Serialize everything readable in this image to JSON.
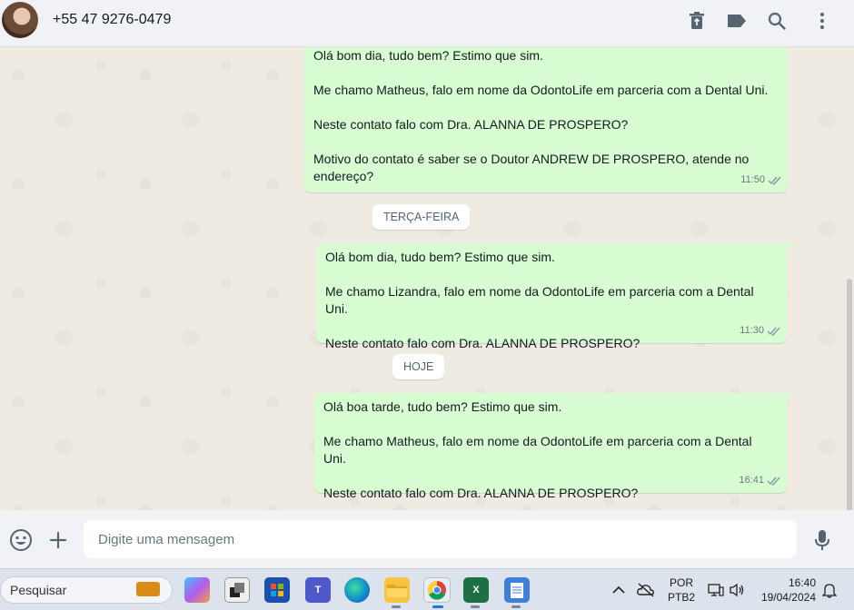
{
  "header": {
    "contact_name": "+55 47 9276-0479",
    "icons": [
      "delete-icon",
      "label-icon",
      "search-icon",
      "menu-icon"
    ]
  },
  "messages": [
    {
      "paragraphs": [
        "Olá bom dia, tudo bem? Estimo que sim.",
        "Me chamo Matheus, falo em nome da OdontoLife em parceria com a Dental Uni.",
        "Neste contato falo com Dra. ALANNA DE PROSPERO?",
        "Motivo do contato é saber se o Doutor ANDREW DE PROSPERO, atende no endereço?"
      ],
      "time": "11:50",
      "status": "read"
    },
    {
      "paragraphs": [
        "Olá bom dia, tudo bem? Estimo que sim.",
        "Me chamo Lizandra, falo em nome da OdontoLife em parceria com a Dental Uni.",
        "Neste contato falo com Dra. ALANNA DE PROSPERO?"
      ],
      "time": "11:30",
      "status": "read"
    },
    {
      "paragraphs": [
        "Olá boa tarde, tudo bem? Estimo que sim.",
        "Me chamo Matheus, falo em nome da OdontoLife em parceria com a Dental Uni.",
        "Neste contato falo com Dra. ALANNA DE PROSPERO?"
      ],
      "time": "16:41",
      "status": "read"
    }
  ],
  "day_separators": [
    "TERÇA-FEIRA",
    "HOJE"
  ],
  "composer": {
    "placeholder": "Digite uma mensagem"
  },
  "taskbar": {
    "search_placeholder": "Pesquisar",
    "apps": [
      "copilot",
      "files",
      "store",
      "teams",
      "edge",
      "explorer",
      "chrome",
      "excel",
      "notepad"
    ],
    "language": "POR",
    "layout": "PTB2",
    "time": "16:40",
    "date": "19/04/2024"
  },
  "colors": {
    "outgoing_bubble": "#d9fdd3",
    "chat_background": "#efeae2",
    "header_background": "#f0f2f5",
    "read_tick": "#53bdeb"
  }
}
